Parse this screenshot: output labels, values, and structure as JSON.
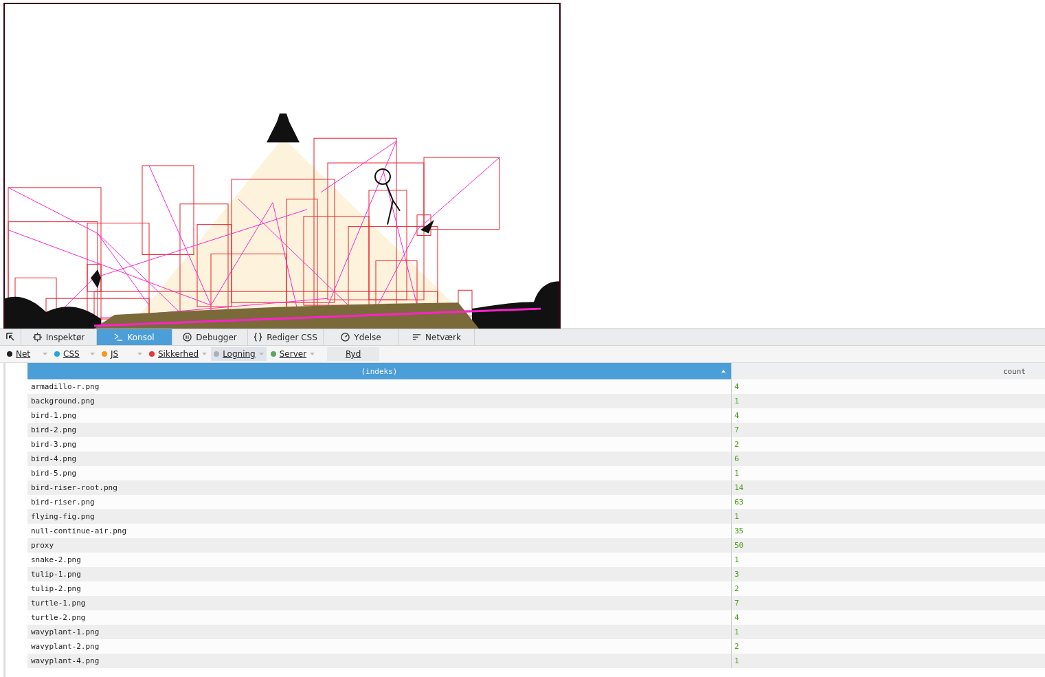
{
  "tabs": [
    {
      "label": "Inspektør",
      "selected": false
    },
    {
      "label": "Konsol",
      "selected": true
    },
    {
      "label": "Debugger",
      "selected": false
    },
    {
      "label": "Rediger CSS",
      "selected": false
    },
    {
      "label": "Ydelse",
      "selected": false
    },
    {
      "label": "Netværk",
      "selected": false
    }
  ],
  "filters": [
    {
      "label": "Net",
      "color": "#222222",
      "selected": false
    },
    {
      "label": "CSS",
      "color": "#1fa7e0",
      "selected": false
    },
    {
      "label": "JS",
      "color": "#f39a1e",
      "selected": false
    },
    {
      "label": "Sikkerhed",
      "color": "#e8353a",
      "selected": false
    },
    {
      "label": "Logning",
      "color": "#a9b1b8",
      "selected": true
    },
    {
      "label": "Server",
      "color": "#5aa85a",
      "selected": false
    }
  ],
  "clear_button": "Ryd",
  "table": {
    "columns": [
      {
        "label": "(indeks)",
        "sorted": true
      },
      {
        "label": "count",
        "sorted": false
      }
    ],
    "rows": [
      [
        "armadillo-r.png",
        "4"
      ],
      [
        "background.png",
        "1"
      ],
      [
        "bird-1.png",
        "4"
      ],
      [
        "bird-2.png",
        "7"
      ],
      [
        "bird-3.png",
        "2"
      ],
      [
        "bird-4.png",
        "6"
      ],
      [
        "bird-5.png",
        "1"
      ],
      [
        "bird-riser-root.png",
        "14"
      ],
      [
        "bird-riser.png",
        "63"
      ],
      [
        "flying-fig.png",
        "1"
      ],
      [
        "null-continue-air.png",
        "35"
      ],
      [
        "proxy",
        "50"
      ],
      [
        "snake-2.png",
        "1"
      ],
      [
        "tulip-1.png",
        "3"
      ],
      [
        "tulip-2.png",
        "2"
      ],
      [
        "turtle-1.png",
        "7"
      ],
      [
        "turtle-2.png",
        "4"
      ],
      [
        "wavyplant-1.png",
        "1"
      ],
      [
        "wavyplant-2.png",
        "2"
      ],
      [
        "wavyplant-4.png",
        "1"
      ]
    ]
  }
}
